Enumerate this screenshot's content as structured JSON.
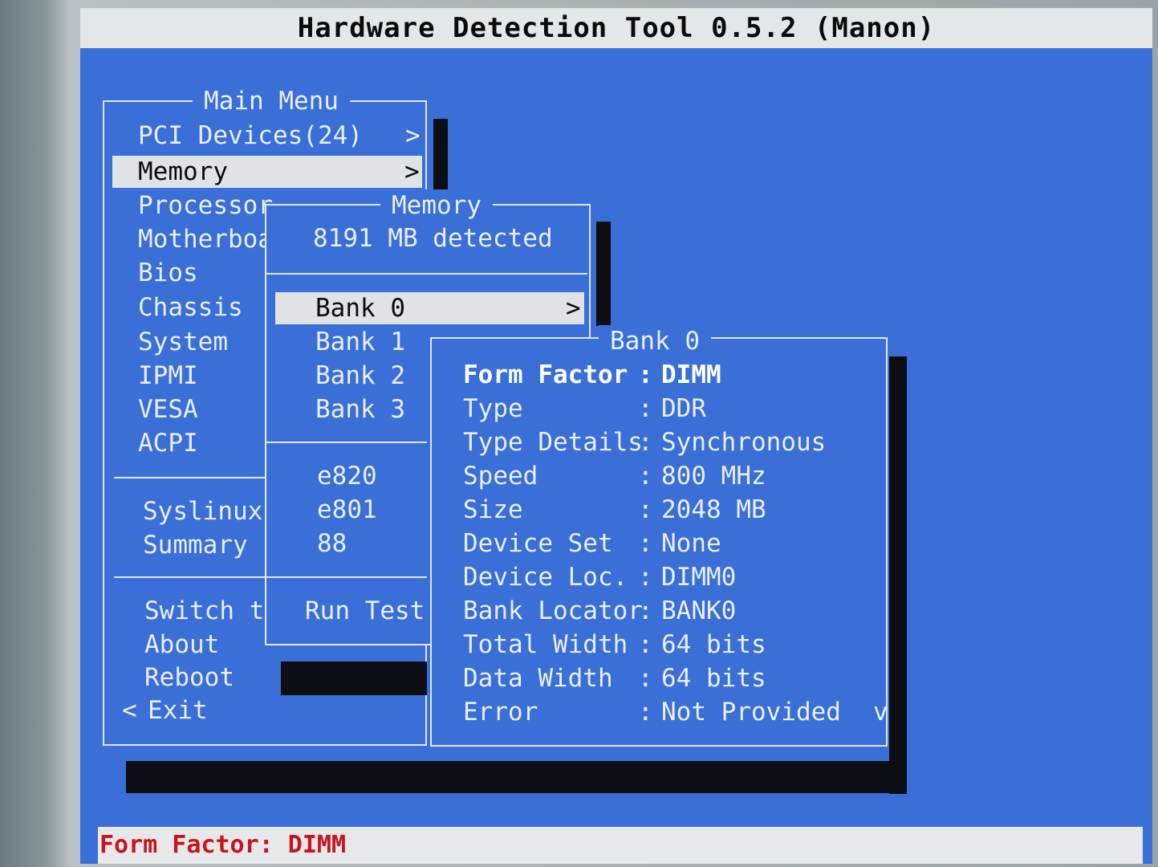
{
  "title": "Hardware Detection Tool 0.5.2 (Manon)",
  "status": "Form Factor: DIMM",
  "main_menu": {
    "title": "Main Menu",
    "items": [
      "PCI Devices(24)",
      "Memory",
      "Processor",
      "Motherboa",
      "Bios",
      "Chassis",
      "System",
      "IPMI",
      "VESA",
      "ACPI"
    ],
    "group2": [
      "Syslinux",
      "Summary"
    ],
    "group3": [
      "Switch to",
      "About",
      "Reboot"
    ],
    "exit": "Exit",
    "submenu_arrow": ">",
    "back_arrow": "<"
  },
  "memory_menu": {
    "title": "Memory",
    "detected": "8191 MB detected",
    "banks": [
      "Bank 0",
      "Bank 1",
      "Bank 2",
      "Bank 3"
    ],
    "maps": [
      "e820",
      "e801",
      "88"
    ],
    "run_test": "Run Test",
    "submenu_arrow": ">"
  },
  "bank_panel": {
    "title": "Bank 0",
    "separator": ":",
    "scroll_indicator": "v",
    "rows": [
      {
        "label": "Form Factor",
        "value": "DIMM"
      },
      {
        "label": "Type",
        "value": "DDR"
      },
      {
        "label": "Type Details",
        "value": "Synchronous"
      },
      {
        "label": "Speed",
        "value": "800 MHz"
      },
      {
        "label": "Size",
        "value": "2048 MB"
      },
      {
        "label": "Device Set",
        "value": "None"
      },
      {
        "label": "Device Loc.",
        "value": "DIMM0"
      },
      {
        "label": "Bank Locator",
        "value": "BANK0"
      },
      {
        "label": "Total Width",
        "value": "64 bits"
      },
      {
        "label": "Data Width",
        "value": "64 bits"
      },
      {
        "label": "Error",
        "value": "Not Provided"
      }
    ]
  },
  "colors": {
    "background": "#3a6fd8",
    "text": "#e9eef8",
    "highlight_bg": "#dfe3e6",
    "status_text": "#c8141c"
  }
}
